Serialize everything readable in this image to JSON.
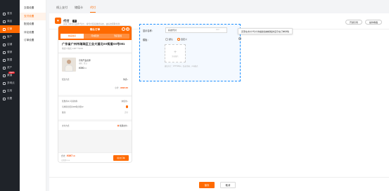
{
  "sidebar": {
    "items": [
      {
        "label": "首页",
        "icon": "home-icon",
        "active": false
      },
      {
        "label": "商品",
        "icon": "box-icon",
        "active": false
      },
      {
        "label": "订单",
        "icon": "order-icon",
        "active": true
      },
      {
        "label": "客户",
        "icon": "user-icon",
        "active": false
      },
      {
        "label": "店铺",
        "icon": "shop-icon",
        "active": false
      },
      {
        "label": "营销",
        "icon": "tag-icon",
        "active": false
      },
      {
        "label": "数据",
        "icon": "chart-icon",
        "active": false
      },
      {
        "label": "资产",
        "icon": "wallet-icon",
        "active": false
      },
      {
        "label": "渠道",
        "icon": "channel-icon",
        "active": false,
        "badge": "NEW"
      },
      {
        "label": "多网点",
        "icon": "store-icon",
        "active": false
      },
      {
        "label": "应用",
        "icon": "apps-icon",
        "active": false
      },
      {
        "label": "设置",
        "icon": "settings-icon",
        "active": false
      }
    ]
  },
  "submenu": {
    "items": [
      {
        "label": "交易设置",
        "active": false
      },
      {
        "label": "支付设置",
        "active": true
      },
      {
        "label": "配送设置",
        "active": false
      },
      {
        "label": "评论设置",
        "active": false
      },
      {
        "label": "订单设置",
        "active": false
      }
    ]
  },
  "tabs": [
    {
      "label": "线上支付",
      "active": false
    },
    {
      "label": "储值卡",
      "active": false
    },
    {
      "label": "代付",
      "active": true
    }
  ],
  "header": {
    "title": "代付",
    "tag": "开",
    "description": "买家下单时可选择“代付”，将代付链接发给好友，由好友帮助付款",
    "btn_share": "开通引导",
    "btn_guide": "操作教程"
  },
  "phone": {
    "title": "确认订单",
    "tabs": [
      "快递发货",
      "同城配送",
      "到店自提"
    ],
    "address_line": "广东省广州市海珠区工业大道北XX街道XX号001",
    "receiver": "收货人姓名  138****0000",
    "product_name": "示例产品名称",
    "product_spec": "规格：默认",
    "product_price": "¥390",
    "product_unit": ".00",
    "delivery_label": "配送方式",
    "delivery_value": "快递",
    "subtotal_label": "小计：",
    "subtotal_value": "¥390.00",
    "coupon_label": "优惠券(1) 可领用券",
    "coupon_value": "未使用",
    "benefit_label": "可用积分抵扣200积分抵¥2",
    "remark_label": "备注",
    "remark_value": "选填",
    "pay_label": "支付方式",
    "pay_value": "找朋友付",
    "total_label": "合计：",
    "total_value": "¥397",
    "total_decimal": ".00",
    "total_note": "已优惠¥2.00",
    "submit": "提交订单"
  },
  "panel": {
    "name_label": "显示名称：",
    "name_value": "好友代付",
    "name_count": "4/10",
    "status_label": "模板：",
    "radio_default": "默认",
    "radio_custom": "自定义",
    "upload_text": "添加图片",
    "upload_tip": "建议尺寸：375*180px，仅支持jpg、png格式",
    "tooltip": "买家在支付“代付”的描述会被模板的显示在订单详情"
  },
  "footer": {
    "save": "保存",
    "cancel": "取消"
  },
  "colors": {
    "accent": "#ff6a00",
    "sidebar_bg": "#1f2329",
    "panel_border": "#1e90ff"
  }
}
